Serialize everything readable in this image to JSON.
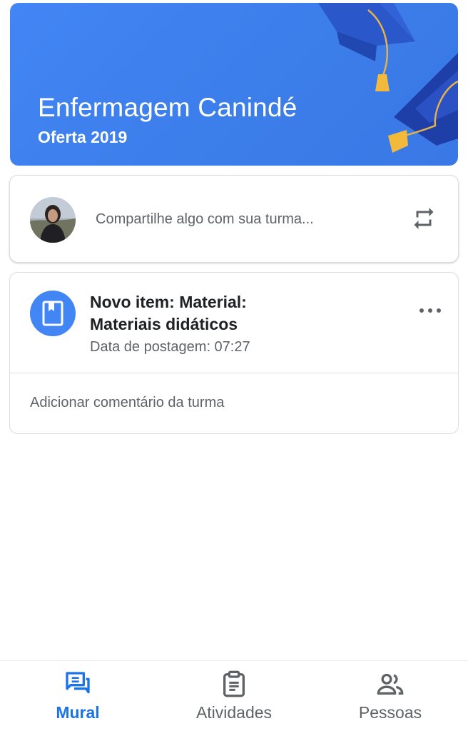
{
  "class_header": {
    "title": "Enfermagem Canindé",
    "subtitle": "Oferta 2019",
    "background_color": "#4285f4",
    "art": "graduation-caps-illustration"
  },
  "share_box": {
    "placeholder": "Compartilhe algo com sua turma...",
    "avatar": "user-avatar-photo",
    "repost_icon": "repost-icon"
  },
  "post": {
    "icon": "material-book-icon",
    "title": "Novo item: Material: Materiais didáticos",
    "date_text": "Data de postagem: 07:27",
    "menu_icon": "more-horizontal-icon",
    "comment_link": "Adicionar comentário da turma"
  },
  "bottom_nav": {
    "active_color": "#1a73e8",
    "items": [
      {
        "label": "Mural",
        "icon": "stream-icon",
        "active": true
      },
      {
        "label": "Atividades",
        "icon": "clipboard-icon",
        "active": false
      },
      {
        "label": "Pessoas",
        "icon": "people-icon",
        "active": false
      }
    ]
  }
}
